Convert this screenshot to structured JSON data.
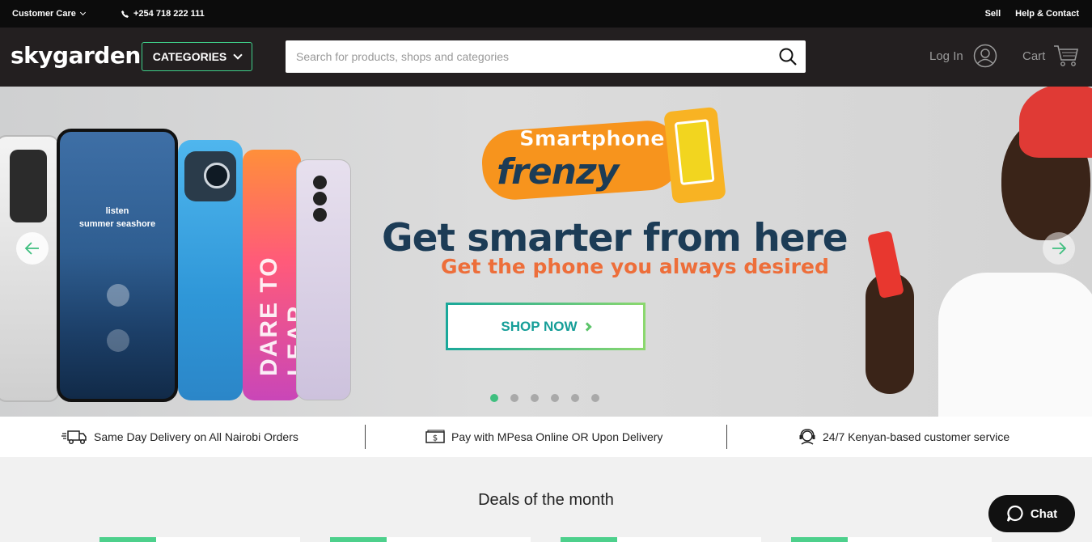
{
  "topbar": {
    "customer_care": "Customer Care",
    "phone": "+254 718 222 111",
    "sell": "Sell",
    "help": "Help & Contact"
  },
  "header": {
    "logo": "skygarden",
    "categories_label": "CATEGORIES",
    "search_placeholder": "Search for products, shops and categories",
    "login_label": "Log In",
    "cart_label": "Cart"
  },
  "hero": {
    "badge_top": "Smartphone",
    "badge_bottom": "frenzy",
    "headline": "Get smarter from here",
    "subline": "Get the phone you always desired",
    "cta": "SHOP NOW",
    "phone_screen_line1": "listen",
    "phone_screen_line2": "summer seashore",
    "phone_case_text": "DARE TO LEAP",
    "slides": 6,
    "active_slide": 1
  },
  "features": [
    {
      "icon": "delivery-truck-icon",
      "label": "Same Day Delivery on All Nairobi Orders"
    },
    {
      "icon": "cash-icon",
      "label": "Pay with MPesa Online OR Upon Delivery"
    },
    {
      "icon": "support-agent-icon",
      "label": "24/7 Kenyan-based customer service"
    }
  ],
  "deals": {
    "title": "Deals of the month"
  },
  "chat": {
    "label": "Chat"
  },
  "colors": {
    "accent_green": "#3fbf7f",
    "header_bg": "#231f20",
    "headline_navy": "#1c3c56",
    "subline_orange": "#ed6e3a"
  }
}
